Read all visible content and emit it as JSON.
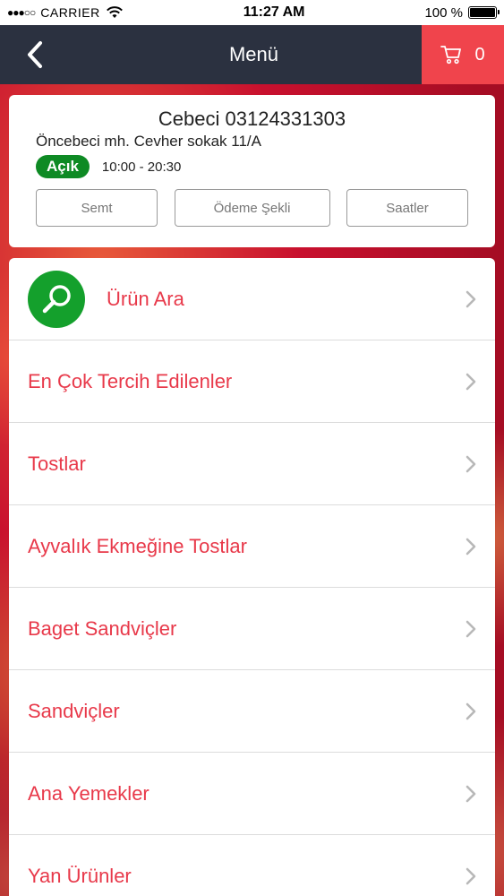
{
  "status_bar": {
    "signal": "●●●○○",
    "carrier": "CARRIER",
    "time": "11:27 AM",
    "battery": "100 %"
  },
  "nav": {
    "title": "Menü",
    "cart_count": "0"
  },
  "store": {
    "name": "Cebeci 03124331303",
    "address": "Öncebeci mh. Cevher sokak 11/A",
    "status": "Açık",
    "hours": "10:00 - 20:30",
    "buttons": [
      "Semt",
      "Ödeme Şekli",
      "Saatler"
    ]
  },
  "menu": {
    "items": [
      {
        "label": "Ürün Ara"
      },
      {
        "label": "En Çok Tercih Edilenler"
      },
      {
        "label": "Tostlar"
      },
      {
        "label": "Ayvalık Ekmeğine Tostlar"
      },
      {
        "label": "Baget Sandviçler"
      },
      {
        "label": "Sandviçler"
      },
      {
        "label": "Ana Yemekler"
      },
      {
        "label": "Yan Ürünler"
      }
    ]
  },
  "colors": {
    "nav_bg": "#2b3140",
    "cart_bg": "#f0444c",
    "accent_red": "#e8394a",
    "open_green": "#0e8a24",
    "search_green": "#14a02c"
  }
}
